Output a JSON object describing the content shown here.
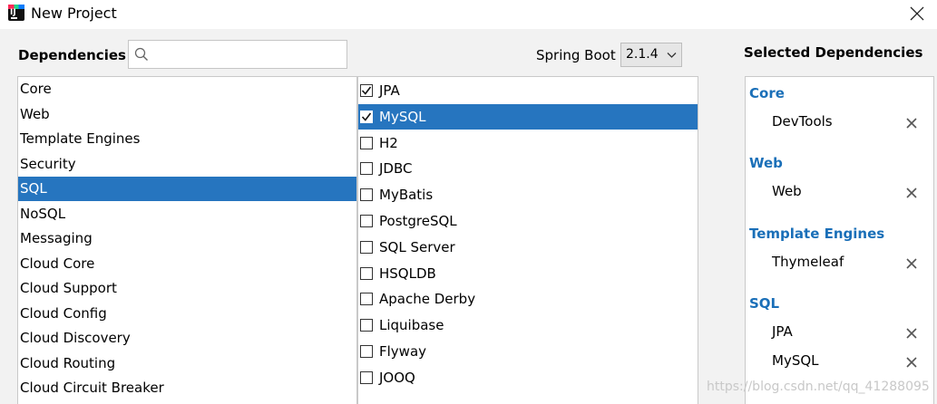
{
  "window": {
    "title": "New Project"
  },
  "header": {
    "dependencies_label": "Dependencies",
    "search": {
      "value": "",
      "placeholder": ""
    },
    "spring_boot_label": "Spring Boot",
    "spring_boot_version": "2.1.4"
  },
  "categories": [
    {
      "label": "Core",
      "selected": false
    },
    {
      "label": "Web",
      "selected": false
    },
    {
      "label": "Template Engines",
      "selected": false
    },
    {
      "label": "Security",
      "selected": false
    },
    {
      "label": "SQL",
      "selected": true
    },
    {
      "label": "NoSQL",
      "selected": false
    },
    {
      "label": "Messaging",
      "selected": false
    },
    {
      "label": "Cloud Core",
      "selected": false
    },
    {
      "label": "Cloud Support",
      "selected": false
    },
    {
      "label": "Cloud Config",
      "selected": false
    },
    {
      "label": "Cloud Discovery",
      "selected": false
    },
    {
      "label": "Cloud Routing",
      "selected": false
    },
    {
      "label": "Cloud Circuit Breaker",
      "selected": false
    }
  ],
  "dependencies": [
    {
      "label": "JPA",
      "checked": true,
      "selected": false
    },
    {
      "label": "MySQL",
      "checked": true,
      "selected": true
    },
    {
      "label": "H2",
      "checked": false,
      "selected": false
    },
    {
      "label": "JDBC",
      "checked": false,
      "selected": false
    },
    {
      "label": "MyBatis",
      "checked": false,
      "selected": false
    },
    {
      "label": "PostgreSQL",
      "checked": false,
      "selected": false
    },
    {
      "label": "SQL Server",
      "checked": false,
      "selected": false
    },
    {
      "label": "HSQLDB",
      "checked": false,
      "selected": false
    },
    {
      "label": "Apache Derby",
      "checked": false,
      "selected": false
    },
    {
      "label": "Liquibase",
      "checked": false,
      "selected": false
    },
    {
      "label": "Flyway",
      "checked": false,
      "selected": false
    },
    {
      "label": "JOOQ",
      "checked": false,
      "selected": false
    }
  ],
  "selected_panel": {
    "title": "Selected Dependencies",
    "groups": [
      {
        "name": "Core",
        "items": [
          "DevTools"
        ]
      },
      {
        "name": "Web",
        "items": [
          "Web"
        ]
      },
      {
        "name": "Template Engines",
        "items": [
          "Thymeleaf"
        ]
      },
      {
        "name": "SQL",
        "items": [
          "JPA",
          "MySQL"
        ]
      }
    ]
  },
  "watermark": "https://blog.csdn.net/qq_41288095",
  "colors": {
    "selection": "#2675bf",
    "group_heading": "#1a6fb8",
    "panel_background": "#f2f2f2"
  }
}
